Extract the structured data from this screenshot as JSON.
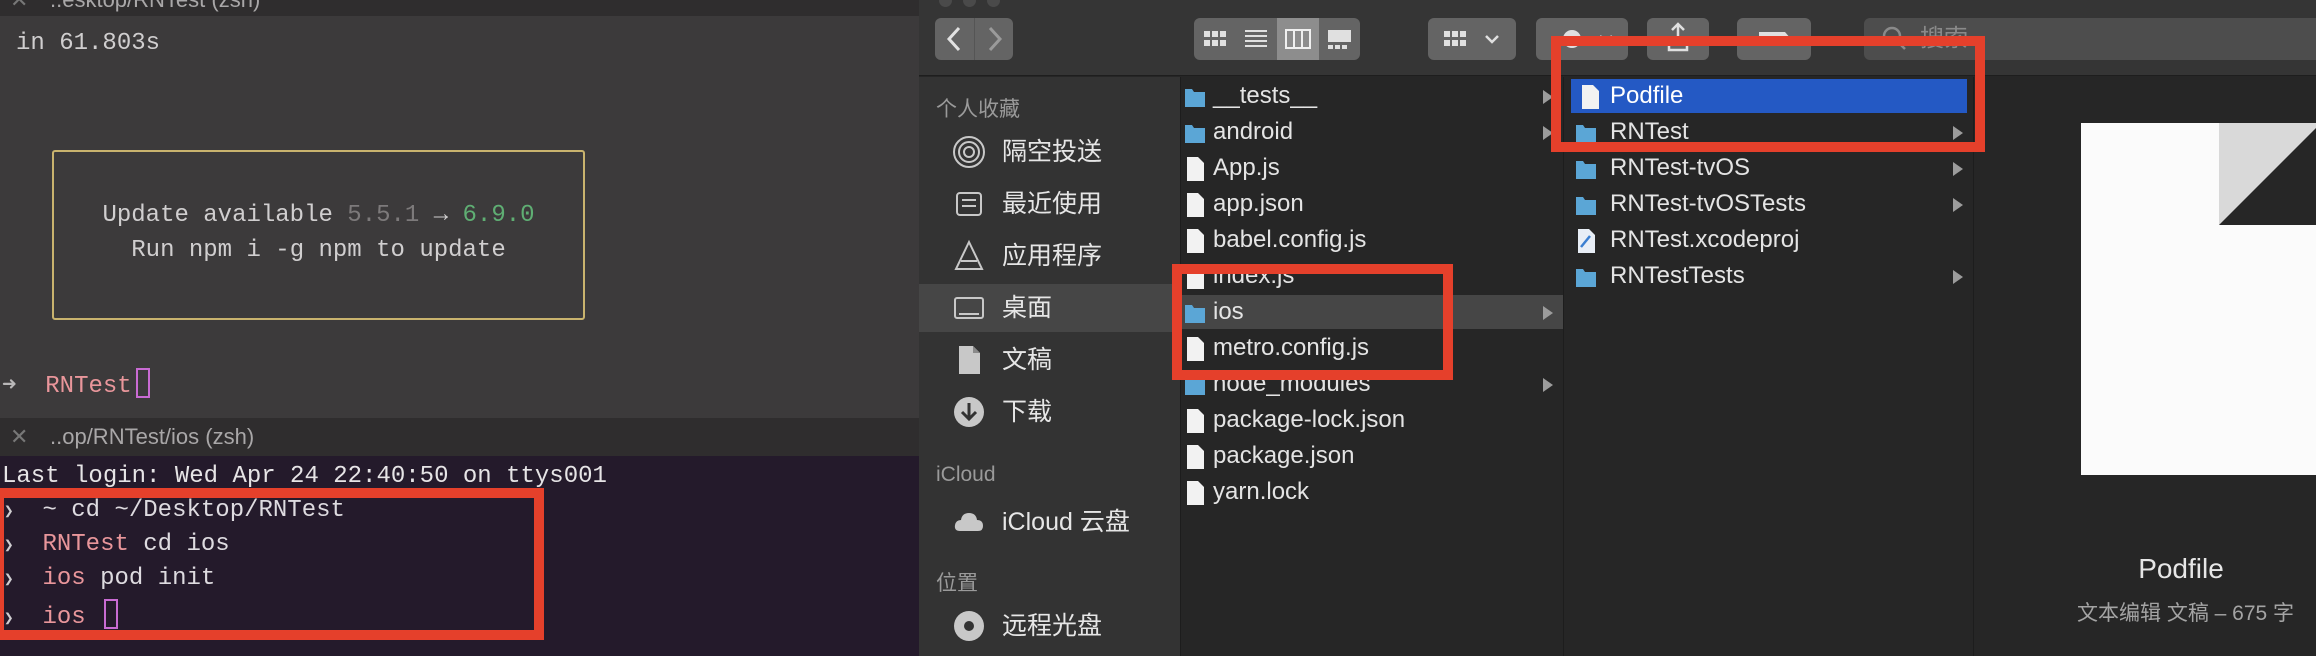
{
  "terminal": {
    "top_title": "..esktop/RNTest (zsh)",
    "elapsed_line": "in 61.803s",
    "update_notice": {
      "label": "Update available",
      "old_version": "5.5.1",
      "arrow": "→",
      "new_version": "6.9.0",
      "run_line": "Run npm i -g npm to update"
    },
    "prompt_arrow": "➜",
    "prompt_dir": "RNTest",
    "bottom_title": "..op/RNTest/ios (zsh)",
    "last_login": "Last login: Wed Apr 24 22:40:50 on ttys001",
    "commands": [
      {
        "dir": "~",
        "cmd": "cd ~/Desktop/RNTest"
      },
      {
        "dir": "RNTest",
        "cmd": "cd ios"
      },
      {
        "dir": "ios",
        "cmd": "pod init"
      },
      {
        "dir": "ios",
        "cmd": ""
      }
    ]
  },
  "finder": {
    "search_placeholder": "搜索",
    "sidebar": {
      "favorites_header": "个人收藏",
      "favorites": [
        {
          "label": "隔空投送",
          "icon": "airdrop-icon"
        },
        {
          "label": "最近使用",
          "icon": "recents-icon"
        },
        {
          "label": "应用程序",
          "icon": "applications-icon"
        },
        {
          "label": "桌面",
          "icon": "desktop-icon",
          "selected": true
        },
        {
          "label": "文稿",
          "icon": "documents-icon"
        },
        {
          "label": "下载",
          "icon": "downloads-icon"
        }
      ],
      "icloud_header": "iCloud",
      "icloud": [
        {
          "label": "iCloud 云盘",
          "icon": "cloud-icon"
        }
      ],
      "locations_header": "位置",
      "locations": [
        {
          "label": "远程光盘",
          "icon": "disc-icon"
        }
      ]
    },
    "column1": [
      {
        "name": "__tests__",
        "type": "folder",
        "has_children": true
      },
      {
        "name": "android",
        "type": "folder",
        "has_children": true
      },
      {
        "name": "App.js",
        "type": "file"
      },
      {
        "name": "app.json",
        "type": "file"
      },
      {
        "name": "babel.config.js",
        "type": "file"
      },
      {
        "name": "index.js",
        "type": "file"
      },
      {
        "name": "ios",
        "type": "folder",
        "has_children": true,
        "highlighted": true
      },
      {
        "name": "metro.config.js",
        "type": "file"
      },
      {
        "name": "node_modules",
        "type": "folder",
        "has_children": true
      },
      {
        "name": "package-lock.json",
        "type": "file"
      },
      {
        "name": "package.json",
        "type": "file"
      },
      {
        "name": "yarn.lock",
        "type": "file"
      }
    ],
    "column2": [
      {
        "name": "Podfile",
        "type": "file",
        "selected": true
      },
      {
        "name": "RNTest",
        "type": "folder",
        "has_children": true
      },
      {
        "name": "RNTest-tvOS",
        "type": "folder",
        "has_children": true
      },
      {
        "name": "RNTest-tvOSTests",
        "type": "folder",
        "has_children": true
      },
      {
        "name": "RNTest.xcodeproj",
        "type": "xcodeproj"
      },
      {
        "name": "RNTestTests",
        "type": "folder",
        "has_children": true
      }
    ],
    "preview": {
      "name": "Podfile",
      "kind": "文本编辑 文稿 – 675 字"
    }
  },
  "colors": {
    "annotation_red": "#e5402b",
    "selection_blue": "#2459c4",
    "folder_blue": "#5ba6d6"
  }
}
